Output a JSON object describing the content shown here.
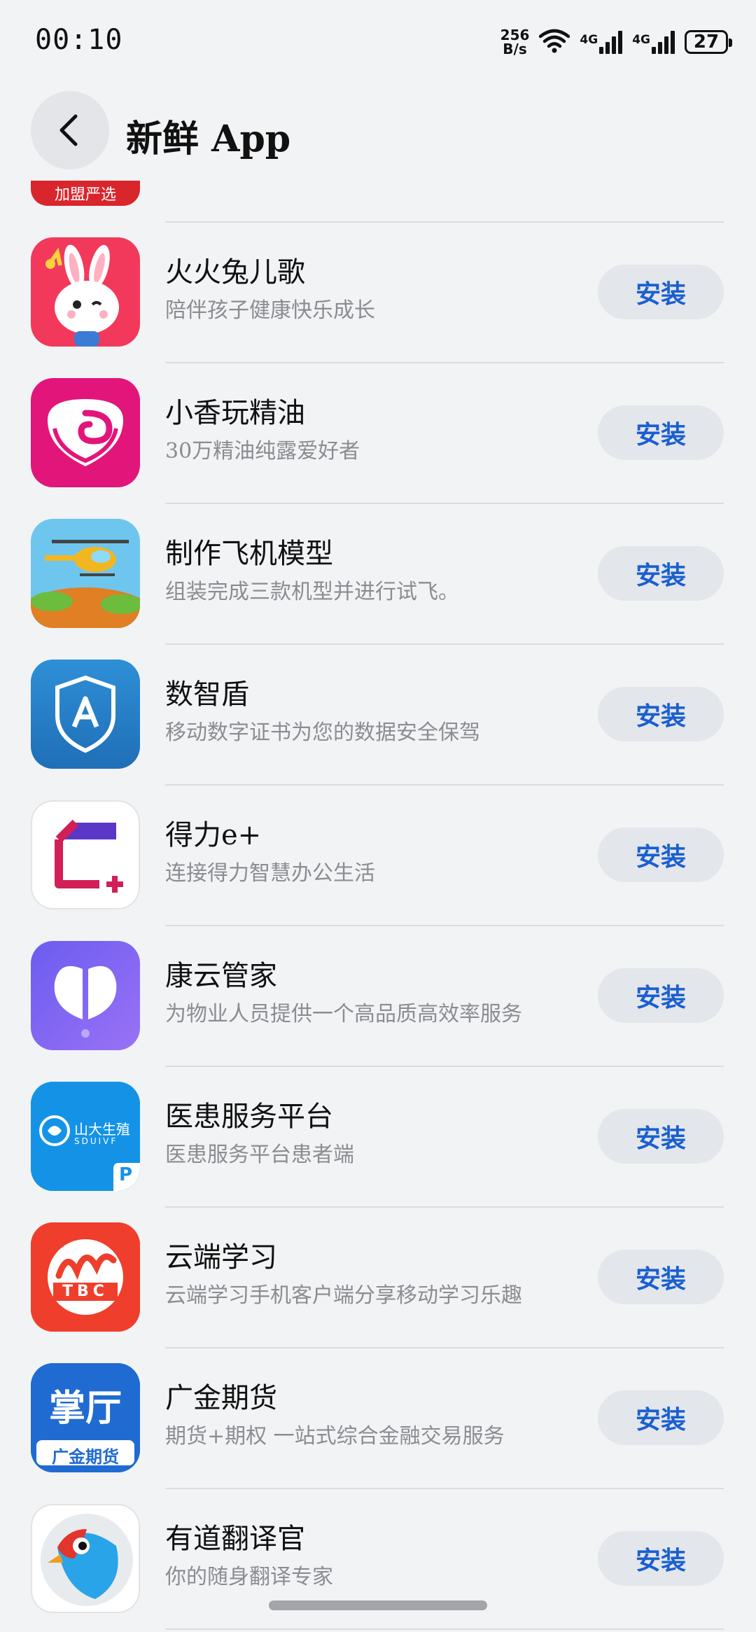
{
  "status": {
    "time": "00:10",
    "net_speed_value": "256",
    "net_speed_unit": "B/s",
    "signal1_label": "4G",
    "signal2_label": "4G",
    "battery": "27"
  },
  "header": {
    "title": "新鲜 App",
    "back_icon": "chevron-left-icon"
  },
  "partial_item": {
    "badge": "加盟严选"
  },
  "install_label": "安装",
  "apps": [
    {
      "name": "火火兔儿歌",
      "desc": "陪伴孩子健康快乐成长",
      "icon": "rabbit-icon"
    },
    {
      "name": "小香玩精油",
      "desc": "30万精油纯露爱好者",
      "icon": "rose-icon"
    },
    {
      "name": "制作飞机模型",
      "desc": "组装完成三款机型并进行试飞。",
      "icon": "helicopter-icon"
    },
    {
      "name": "数智盾",
      "desc": "移动数字证书为您的数据安全保驾",
      "icon": "shield-icon"
    },
    {
      "name": "得力e+",
      "desc": "连接得力智慧办公生活",
      "icon": "deli-icon"
    },
    {
      "name": "康云管家",
      "desc": "为物业人员提供一个高品质高效率服务",
      "icon": "butterfly-icon"
    },
    {
      "name": "医患服务平台",
      "desc": "医患服务平台患者端",
      "icon": "hospital-icon",
      "icon_text": "山大生殖",
      "icon_subtext": "SDUIVF",
      "icon_badge": "P"
    },
    {
      "name": "云端学习",
      "desc": "云端学习手机客户端分享移动学习乐趣",
      "icon": "tbc-icon",
      "icon_text": "TBC"
    },
    {
      "name": "广金期货",
      "desc": "期货+期权 一站式综合金融交易服务",
      "icon": "futures-icon",
      "icon_text": "掌厅",
      "icon_subtext": "广金期货"
    },
    {
      "name": "有道翻译官",
      "desc": "你的随身翻译专家",
      "icon": "bird-icon"
    }
  ],
  "colors": {
    "background": "#f1f3f5",
    "install_text": "#1a5fd0",
    "install_bg": "#e3e6ea",
    "badge_red": "#d9262c"
  }
}
